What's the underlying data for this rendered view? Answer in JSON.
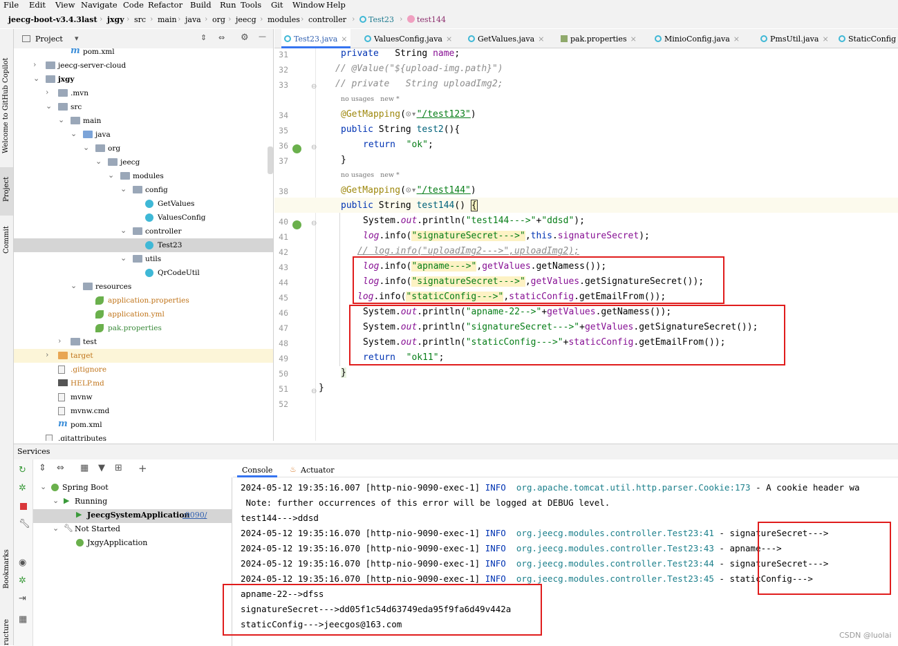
{
  "menu": [
    "File",
    "Edit",
    "View",
    "Navigate",
    "Code",
    "Refactor",
    "Build",
    "Run",
    "Tools",
    "Git",
    "Window",
    "Help"
  ],
  "breadcrumb": [
    "jeecg-boot-v3.4.3last",
    "jxgy",
    "src",
    "main",
    "java",
    "org",
    "jeecg",
    "modules",
    "controller",
    "Test23",
    "test144"
  ],
  "left_strip": {
    "copilot": "Welcome to GitHub Copilot",
    "project": "Project",
    "commit": "Commit",
    "bookmarks": "Bookmarks",
    "structure": "ructure"
  },
  "project": {
    "title": "Project",
    "tree": [
      {
        "label": "pom.xml",
        "indent": 3,
        "icon": "maven"
      },
      {
        "label": "jeecg-server-cloud",
        "indent": 1,
        "icon": "folder",
        "arrow": "right"
      },
      {
        "label": "jxgy",
        "indent": 1,
        "icon": "folder",
        "arrow": "down",
        "bold": true
      },
      {
        "label": ".mvn",
        "indent": 2,
        "icon": "folder",
        "arrow": "right"
      },
      {
        "label": "src",
        "indent": 2,
        "icon": "folder",
        "arrow": "down"
      },
      {
        "label": "main",
        "indent": 3,
        "icon": "folder",
        "arrow": "down"
      },
      {
        "label": "java",
        "indent": 4,
        "icon": "folder-blue",
        "arrow": "down"
      },
      {
        "label": "org",
        "indent": 5,
        "icon": "folder",
        "arrow": "down"
      },
      {
        "label": "jeecg",
        "indent": 6,
        "icon": "folder",
        "arrow": "down"
      },
      {
        "label": "modules",
        "indent": 7,
        "icon": "folder",
        "arrow": "down"
      },
      {
        "label": "config",
        "indent": 8,
        "icon": "folder",
        "arrow": "down"
      },
      {
        "label": "GetValues",
        "indent": 9,
        "icon": "class"
      },
      {
        "label": "ValuesConfig",
        "indent": 9,
        "icon": "class"
      },
      {
        "label": "controller",
        "indent": 8,
        "icon": "folder",
        "arrow": "down"
      },
      {
        "label": "Test23",
        "indent": 9,
        "icon": "class",
        "selected": true
      },
      {
        "label": "utils",
        "indent": 8,
        "icon": "folder",
        "arrow": "down"
      },
      {
        "label": "QrCodeUtil",
        "indent": 9,
        "icon": "class"
      },
      {
        "label": "resources",
        "indent": 4,
        "icon": "folder",
        "arrow": "down"
      },
      {
        "label": "application.properties",
        "indent": 5,
        "icon": "leaf",
        "color": "orange"
      },
      {
        "label": "application.yml",
        "indent": 5,
        "icon": "leaf",
        "color": "orange"
      },
      {
        "label": "pak.properties",
        "indent": 5,
        "icon": "leaf",
        "color": "green"
      },
      {
        "label": "test",
        "indent": 3,
        "icon": "folder",
        "arrow": "right"
      },
      {
        "label": "target",
        "indent": 2,
        "icon": "folder-orange",
        "arrow": "right",
        "highlight": true,
        "color": "orange"
      },
      {
        "label": ".gitignore",
        "indent": 2,
        "icon": "file",
        "color": "orange"
      },
      {
        "label": "HELP.md",
        "indent": 2,
        "icon": "md",
        "color": "orange"
      },
      {
        "label": "mvnw",
        "indent": 2,
        "icon": "file"
      },
      {
        "label": "mvnw.cmd",
        "indent": 2,
        "icon": "file"
      },
      {
        "label": "pom.xml",
        "indent": 2,
        "icon": "maven"
      },
      {
        "label": ".gitattributes",
        "indent": 1,
        "icon": "file"
      }
    ]
  },
  "tabs": [
    {
      "label": "Test23.java",
      "active": true
    },
    {
      "label": "ValuesConfig.java"
    },
    {
      "label": "GetValues.java"
    },
    {
      "label": "pak.properties"
    },
    {
      "label": "MinioConfig.java"
    },
    {
      "label": "PmsUtil.java"
    },
    {
      "label": "StaticConfig"
    }
  ],
  "code": {
    "line_numbers": [
      "31",
      "32",
      "33",
      "34",
      "35",
      "36",
      "37",
      "38",
      "39",
      "40",
      "41",
      "42",
      "43",
      "44",
      "45",
      "46",
      "47",
      "48",
      "49",
      "50",
      "51",
      "52"
    ],
    "hint1": "no usages   new *",
    "hint2": "no usages   new *"
  },
  "services": {
    "title": "Services",
    "tree": [
      {
        "label": "Spring Boot",
        "indent": 0
      },
      {
        "label": "Running",
        "indent": 1
      },
      {
        "label": "JeecgSystemApplication",
        "indent": 2,
        "port": ":9090/",
        "bold": true
      },
      {
        "label": "Not Started",
        "indent": 1
      },
      {
        "label": "JxgyApplication",
        "indent": 2
      }
    ],
    "console_tab": "Console",
    "actuator_tab": "Actuator",
    "lines": [
      {
        "ts": "2024-05-12 19:35:16.007 [http-nio-9090-exec-1] ",
        "lvl": "INFO",
        "logger": "org.apache.tomcat.util.http.parser.Cookie:173",
        "msg": " - A cookie header wa"
      },
      {
        "plain": " Note: further occurrences of this error will be logged at DEBUG level."
      },
      {
        "plain": "test144--->ddsd"
      },
      {
        "ts": "2024-05-12 19:35:16.070 [http-nio-9090-exec-1] ",
        "lvl": "INFO",
        "logger": "org.jeecg.modules.controller.Test23:41",
        "msg": " - signatureSecret--->"
      },
      {
        "ts": "2024-05-12 19:35:16.070 [http-nio-9090-exec-1] ",
        "lvl": "INFO",
        "logger": "org.jeecg.modules.controller.Test23:43",
        "msg": " - apname--->"
      },
      {
        "ts": "2024-05-12 19:35:16.070 [http-nio-9090-exec-1] ",
        "lvl": "INFO",
        "logger": "org.jeecg.modules.controller.Test23:44",
        "msg": " - signatureSecret--->"
      },
      {
        "ts": "2024-05-12 19:35:16.070 [http-nio-9090-exec-1] ",
        "lvl": "INFO",
        "logger": "org.jeecg.modules.controller.Test23:45",
        "msg": " - staticConfig--->"
      },
      {
        "plain": "apname-22-->dfss"
      },
      {
        "plain": "signatureSecret--->dd05f1c54d63749eda95f9fa6d49v442a"
      },
      {
        "plain": "staticConfig--->jeecgos@163.com"
      }
    ]
  },
  "watermark": "CSDN @luolai",
  "colors": {
    "highlight_box": "#e01c1c",
    "keyword": "#0033b3",
    "string": "#067d17",
    "annotation": "#9e880d",
    "field": "#871094"
  }
}
